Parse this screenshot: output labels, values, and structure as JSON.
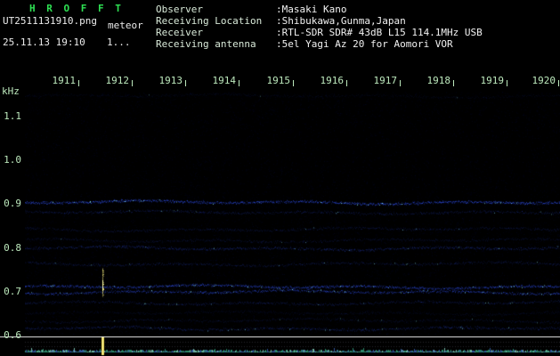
{
  "header": {
    "title": "H R O F F T",
    "filename": "UT2511131910.png",
    "mode": "meteor",
    "timestamp": "25.11.13 19:10",
    "counter": "1...",
    "fields": [
      {
        "label": "Observer",
        "value": ":Masaki Kano"
      },
      {
        "label": "Receiving Location",
        "value": ":Shibukawa,Gunma,Japan"
      },
      {
        "label": "Receiver",
        "value": ":RTL-SDR SDR# 43dB L15 114.1MHz USB"
      },
      {
        "label": "Receiving antenna",
        "value": ":5el Yagi Az 20 for Aomori VOR"
      }
    ]
  },
  "chart_data": {
    "type": "heatmap",
    "title": "HROFFT 10-minute meteor radio spectrogram",
    "x_ticks": [
      "1911",
      "1912",
      "1913",
      "1914",
      "1915",
      "1916",
      "1917",
      "1918",
      "1919",
      "1920"
    ],
    "ylabel": "kHz",
    "y_ticks": [
      "1.1",
      "1.0",
      "0.9",
      "0.8",
      "0.7",
      "0.6"
    ],
    "ylim": [
      0.6,
      1.15
    ],
    "grid": false,
    "noise_bands": [
      {
        "freq_khz": 1.148,
        "intensity": 0.12
      },
      {
        "freq_khz": 0.905,
        "intensity": 0.8
      },
      {
        "freq_khz": 0.882,
        "intensity": 0.3
      },
      {
        "freq_khz": 0.843,
        "intensity": 0.25
      },
      {
        "freq_khz": 0.818,
        "intensity": 0.2
      },
      {
        "freq_khz": 0.8,
        "intensity": 0.4
      },
      {
        "freq_khz": 0.764,
        "intensity": 0.28
      },
      {
        "freq_khz": 0.712,
        "intensity": 0.75
      },
      {
        "freq_khz": 0.7,
        "intensity": 0.65
      },
      {
        "freq_khz": 0.675,
        "intensity": 0.3
      },
      {
        "freq_khz": 0.652,
        "intensity": 0.15
      },
      {
        "freq_khz": 0.635,
        "intensity": 0.2
      },
      {
        "freq_khz": 0.617,
        "intensity": 0.35
      }
    ],
    "meteor_echo": {
      "time_offset_min": 1.45,
      "freq_khz_range": [
        0.69,
        0.755
      ]
    },
    "level_strip": {
      "spike_offset_min": 1.45
    },
    "colors": {
      "background": "#000000",
      "noise_blue": "#2d4be1",
      "peak_cyan": "#8cf0ff",
      "echo_yellow": "#ffe860",
      "axis_text": "#bce8bc",
      "title_green": "#2ee153"
    }
  }
}
